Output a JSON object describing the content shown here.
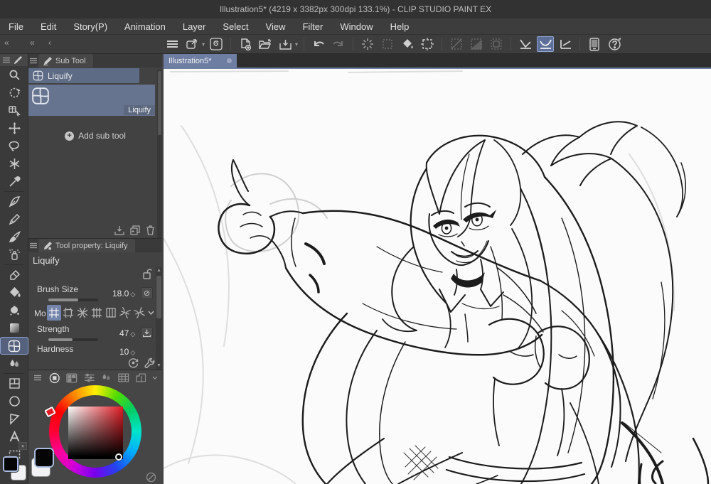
{
  "window": {
    "title": "Illustration5* (4219 x 3382px 300dpi 133.1%)  - CLIP STUDIO PAINT EX"
  },
  "menu": {
    "items": [
      "File",
      "Edit",
      "Story(P)",
      "Animation",
      "Layer",
      "Select",
      "View",
      "Filter",
      "Window",
      "Help"
    ]
  },
  "subtool_panel": {
    "tab_label": "Sub Tool",
    "group_label": "Liquify",
    "tool_label": "Liquify",
    "add_button_label": "Add sub tool"
  },
  "tool_property_panel": {
    "tab_label": "Tool property: Liquify",
    "title": "Liquify",
    "brush_size": {
      "label": "Brush Size",
      "value": "18.0"
    },
    "mode": {
      "label": "Mo"
    },
    "strength": {
      "label": "Strength",
      "value": "47"
    },
    "hardness": {
      "label": "Hardness",
      "value": "10"
    }
  },
  "document": {
    "tab_label": "Illustration5*",
    "canvas_description": "Monochrome anime-style line art: a long-haired woman pointing up-left with an outstretched arm, open jacket off the shoulder, fitted top and belt; faint gray sketch lines remain around the hand and left edge."
  },
  "colors": {
    "selection_accent": "#6e7ea3",
    "tool_highlight": "#55617d",
    "panel_bg": "#434343",
    "canvas_bg": "#fbfbfb",
    "picker_hue": "#e01b24",
    "foreground_color": "#000000",
    "background_color": "#ffffff"
  }
}
